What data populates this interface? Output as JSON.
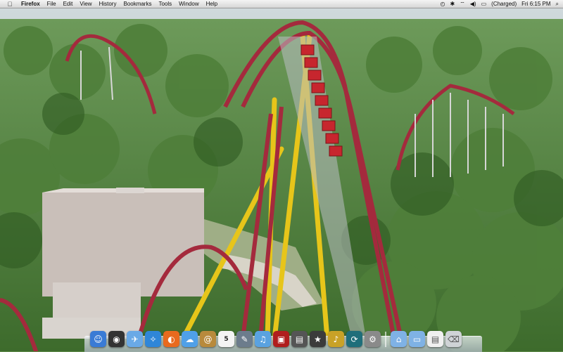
{
  "menubar": {
    "apple_icon": "apple-logo-icon",
    "app_name": "Firefox",
    "menus": [
      "File",
      "Edit",
      "View",
      "History",
      "Bookmarks",
      "Tools",
      "Window",
      "Help"
    ],
    "status": {
      "battery_label": "(Charged)",
      "clock": "Fri 6:15 PM"
    }
  },
  "wallpaper": {
    "subject": "roller-coaster-photo"
  },
  "dock": {
    "items": [
      {
        "name": "finder-icon",
        "color": "#3a7bd5",
        "glyph": "☺"
      },
      {
        "name": "dashboard-icon",
        "color": "#333333",
        "glyph": "◉"
      },
      {
        "name": "mail-icon",
        "color": "#6aa9e6",
        "glyph": "✈"
      },
      {
        "name": "safari-icon",
        "color": "#2f86d8",
        "glyph": "✧"
      },
      {
        "name": "firefox-icon",
        "color": "#e86a1e",
        "glyph": "◐"
      },
      {
        "name": "ichat-icon",
        "color": "#4fa0e8",
        "glyph": "☁"
      },
      {
        "name": "address-book-icon",
        "color": "#b88a3c",
        "glyph": "@"
      },
      {
        "name": "ical-icon",
        "color": "#f4f4f4",
        "glyph": "5"
      },
      {
        "name": "preview-icon",
        "color": "#6c7c8c",
        "glyph": "✎"
      },
      {
        "name": "itunes-icon",
        "color": "#5aa2e0",
        "glyph": "♫"
      },
      {
        "name": "photo-booth-icon",
        "color": "#b01e1e",
        "glyph": "▣"
      },
      {
        "name": "iphoto-icon",
        "color": "#555555",
        "glyph": "▤"
      },
      {
        "name": "imovie-icon",
        "color": "#3b3b3b",
        "glyph": "★"
      },
      {
        "name": "garageband-icon",
        "color": "#c9a227",
        "glyph": "♪"
      },
      {
        "name": "time-machine-icon",
        "color": "#1f6e7a",
        "glyph": "⟳"
      },
      {
        "name": "system-preferences-icon",
        "color": "#8a8a8a",
        "glyph": "⚙"
      },
      {
        "name": "applications-folder-icon",
        "color": "#7fb2e5",
        "glyph": "⌂"
      },
      {
        "name": "documents-folder-icon",
        "color": "#7fb2e5",
        "glyph": "▭"
      },
      {
        "name": "document-icon",
        "color": "#f0f0f0",
        "glyph": "▤"
      },
      {
        "name": "trash-icon",
        "color": "#cfd3d6",
        "glyph": "⌫"
      }
    ]
  }
}
